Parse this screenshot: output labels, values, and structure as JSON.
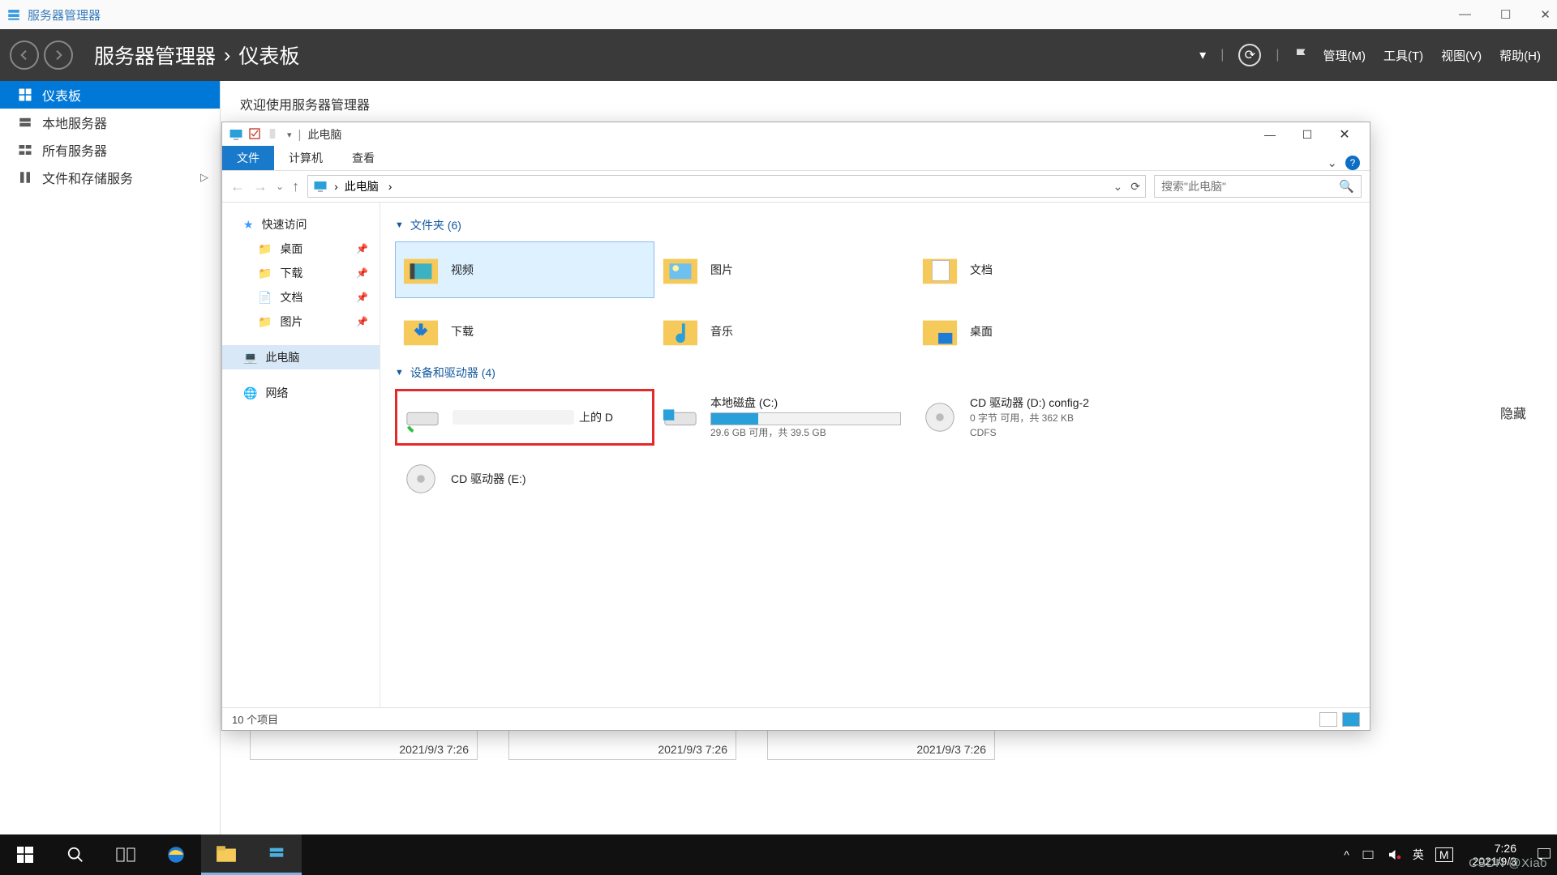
{
  "server_manager": {
    "title": "服务器管理器",
    "breadcrumb_root": "服务器管理器",
    "breadcrumb_sep": "•",
    "breadcrumb_page": "仪表板",
    "menus": [
      "管理(M)",
      "工具(T)",
      "视图(V)",
      "帮助(H)"
    ],
    "sidebar": [
      {
        "label": "仪表板",
        "selected": true
      },
      {
        "label": "本地服务器"
      },
      {
        "label": "所有服务器"
      },
      {
        "label": "文件和存储服务",
        "has_sub": true
      }
    ],
    "welcome": "欢迎使用服务器管理器",
    "card_times": [
      "2021/9/3 7:26",
      "2021/9/3 7:26",
      "2021/9/3 7:26"
    ],
    "hide_label": "隐藏"
  },
  "explorer": {
    "title": "此电脑",
    "tabs": [
      "文件",
      "计算机",
      "查看"
    ],
    "addr_crumbs": [
      "此电脑"
    ],
    "search_placeholder": "搜索\"此电脑\"",
    "nav_pane": {
      "quick": "快速访问",
      "quick_items": [
        "桌面",
        "下载",
        "文档",
        "图片"
      ],
      "this_pc": "此电脑",
      "network": "网络"
    },
    "group_folders_label": "文件夹 (6)",
    "folders": [
      "视频",
      "图片",
      "文档",
      "下载",
      "音乐",
      "桌面"
    ],
    "group_drives_label": "设备和驱动器 (4)",
    "drives": {
      "redacted_suffix": "上的 D",
      "c_label": "本地磁盘 (C:)",
      "c_free": "29.6 GB 可用，共 39.5 GB",
      "d_label": "CD 驱动器 (D:) config-2",
      "d_free": "0 字节 可用，共 362 KB",
      "d_fs": "CDFS",
      "e_label": "CD 驱动器 (E:)"
    },
    "status": "10 个项目"
  },
  "taskbar": {
    "tray": [
      "英",
      "M"
    ],
    "time": "7:26",
    "date": "2021/9/3",
    "watermark": "CSDN @Xiao"
  }
}
